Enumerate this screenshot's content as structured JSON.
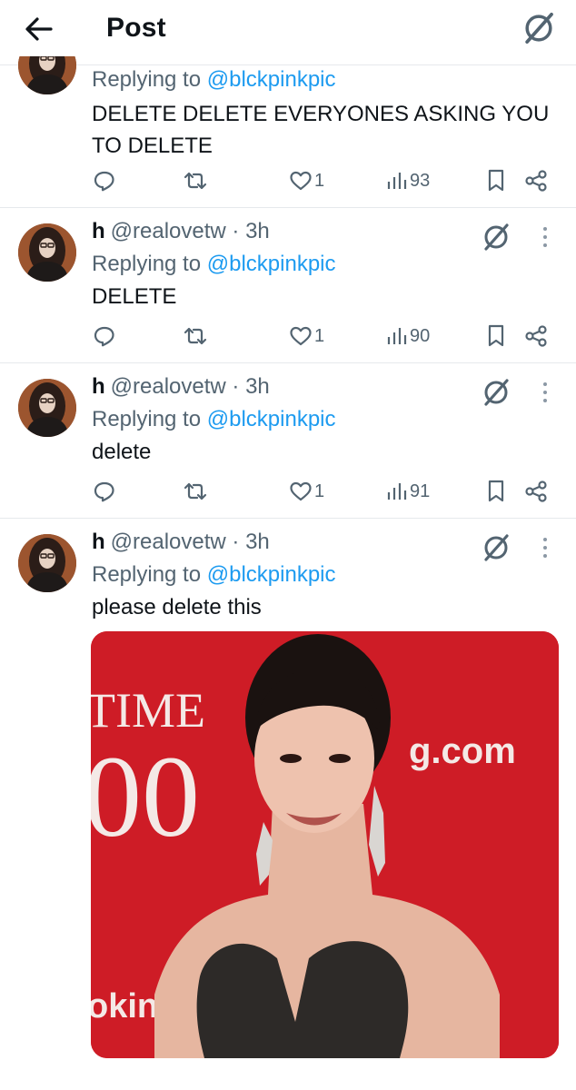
{
  "header": {
    "title": "Post",
    "back_icon": "arrow-left-icon",
    "grok_icon": "grok-icon"
  },
  "colors": {
    "link": "#1d9bf0",
    "muted": "#536471",
    "text": "#0f1419",
    "divider": "#e6e9ec"
  },
  "tweets": [
    {
      "replying_prefix": "Replying to ",
      "replying_handle": "@blckpinkpic",
      "text": "DELETE DELETE EVERYONES ASKING YOU TO DELETE",
      "likes": "1",
      "views": "93"
    },
    {
      "name": "h",
      "meta": "@realovetw · 3h",
      "replying_prefix": "Replying to ",
      "replying_handle": "@blckpinkpic",
      "text": "DELETE",
      "likes": "1",
      "views": "90"
    },
    {
      "name": "h",
      "meta": "@realovetw · 3h",
      "replying_prefix": "Replying to ",
      "replying_handle": "@blckpinkpic",
      "text": "delete",
      "likes": "1",
      "views": "91"
    },
    {
      "name": "h",
      "meta": "@realovetw · 3h",
      "replying_prefix": "Replying to ",
      "replying_handle": "@blckpinkpic",
      "text": "please delete this",
      "media": {
        "backdrop_text_1": "TIME",
        "backdrop_text_2": "00",
        "backdrop_text_3": "g.com",
        "backdrop_text_4": "oking.c"
      }
    }
  ]
}
